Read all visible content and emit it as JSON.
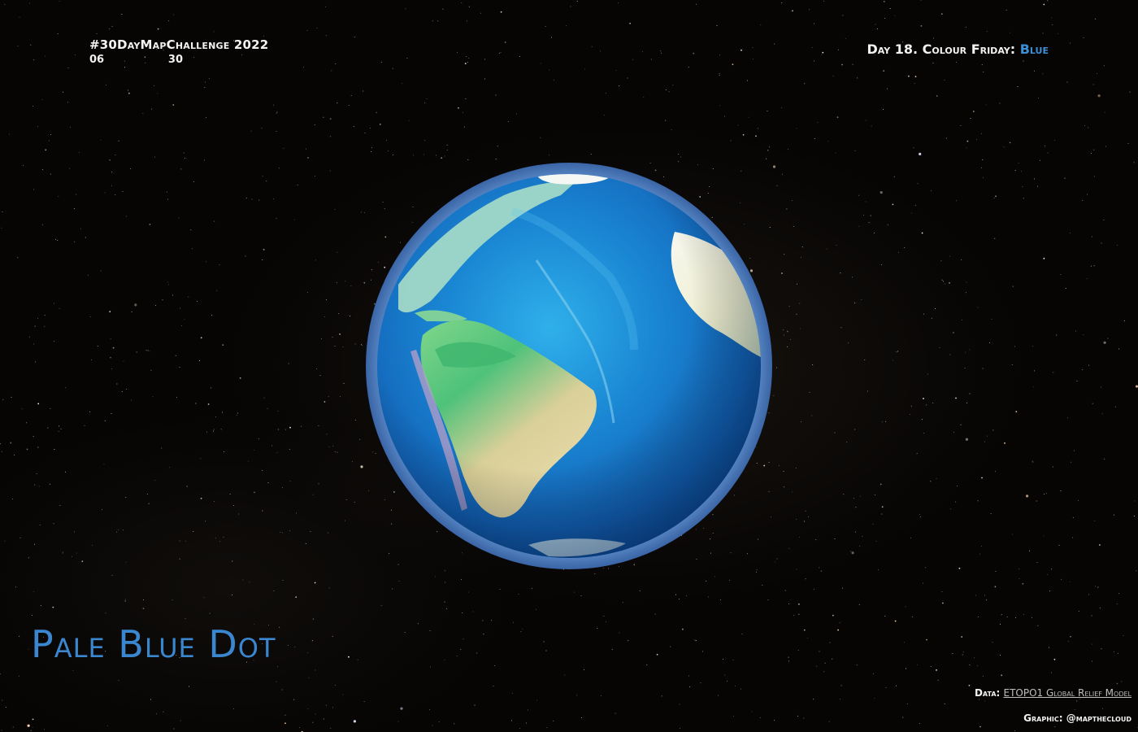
{
  "header": {
    "challenge_title": "#30DayMapChallenge 2022",
    "progress_current": "06",
    "progress_total": "30",
    "day_label": "Day 18. Colour Friday:",
    "day_theme": "Blue"
  },
  "title": "Pale Blue Dot",
  "credits": {
    "data_label": "Data:",
    "data_source": "ETOPO1 Global Relief Model",
    "graphic": "Graphic: @mapthecloud"
  },
  "colors": {
    "accent": "#3a87cf",
    "text": "#f2f2f2",
    "background": "#060504",
    "ocean": "#1a7fd0",
    "land_green": "#4fc27a",
    "land_tan": "#e6d7a2",
    "ice": "#f4f7f4"
  },
  "map": {
    "projection": "orthographic",
    "view": "Atlantic Ocean with South America and Africa"
  }
}
